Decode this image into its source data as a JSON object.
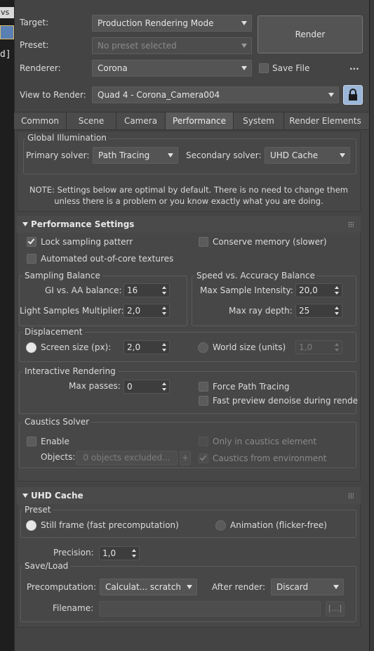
{
  "background": {
    "left_text_1": "vs",
    "left_text_2": "d]"
  },
  "header": {
    "target_label": "Target:",
    "target_value": "Production Rendering Mode",
    "preset_label": "Preset:",
    "preset_value": "No preset selected",
    "renderer_label": "Renderer:",
    "renderer_value": "Corona",
    "save_file_label": "Save File",
    "save_file_checked": false,
    "ellipsis": "...",
    "render_button": "Render",
    "view_label": "View to Render:",
    "view_value": "Quad 4 - Corona_Camera004"
  },
  "tabs": [
    "Common",
    "Scene",
    "Camera",
    "Performance",
    "System",
    "Render Elements"
  ],
  "active_tab": "Performance",
  "gi": {
    "title": "Global Illumination",
    "primary_label": "Primary solver:",
    "primary_value": "Path Tracing",
    "secondary_label": "Secondary solver:",
    "secondary_value": "UHD Cache",
    "note_line1": "NOTE: Settings below are optimal by default. There is no need to change them",
    "note_line2": "unless there is a problem or you know exactly what you are doing."
  },
  "performance": {
    "header": "Performance Settings",
    "lock_sampling": "Lock sampling patterr",
    "lock_sampling_checked": true,
    "conserve_memory": "Conserve memory (slower)",
    "automated_textures": "Automated out-of-core textures",
    "sampling_balance": {
      "title": "Sampling Balance",
      "gi_aa_label": "GI vs. AA balance:",
      "gi_aa_value": "16",
      "light_samples_label": "Light Samples Multiplier:",
      "light_samples_value": "2,0"
    },
    "speed_accuracy": {
      "title": "Speed vs. Accuracy Balance",
      "max_sample_label": "Max Sample Intensity:",
      "max_sample_value": "20,0",
      "max_ray_label": "Max ray depth:",
      "max_ray_value": "25"
    },
    "displacement": {
      "title": "Displacement",
      "screen_size_label": "Screen size (px):",
      "screen_size_value": "2,0",
      "world_size_label": "World size (units)",
      "world_size_value": "1,0"
    },
    "interactive": {
      "title": "Interactive Rendering",
      "max_passes_label": "Max passes:",
      "max_passes_value": "0",
      "force_path_tracing": "Force Path Tracing",
      "fast_preview": "Fast preview denoise during rende"
    },
    "caustics": {
      "title": "Caustics Solver",
      "enable": "Enable",
      "objects_label": "Objects:",
      "objects_value": "0 objects excluded...",
      "plus": "+",
      "only_caustics": "Only in caustics element",
      "caustics_env": "Caustics from environment",
      "caustics_env_checked": true
    }
  },
  "uhd": {
    "header": "UHD Cache",
    "preset_title": "Preset",
    "still_frame": "Still frame (fast precomputation)",
    "animation": "Animation (flicker-free)",
    "precision_label": "Precision:",
    "precision_value": "1,0",
    "save_load_title": "Save/Load",
    "precomputation_label": "Precomputation:",
    "precomputation_value": "Calculat... scratch",
    "after_render_label": "After render:",
    "after_render_value": "Discard",
    "filename_label": "Filename:",
    "filename_value": "",
    "browse": "[...]"
  }
}
